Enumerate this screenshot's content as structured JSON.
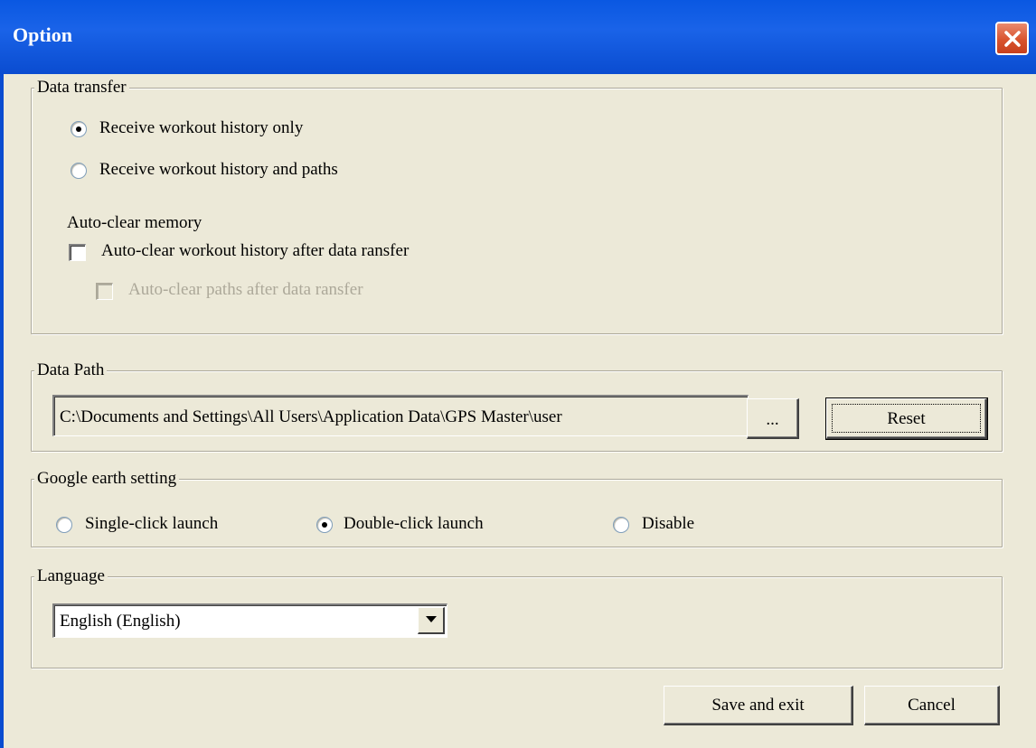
{
  "window": {
    "title": "Option"
  },
  "data_transfer": {
    "group_label": "Data transfer",
    "radio_options": [
      {
        "label": "Receive workout history only",
        "checked": true
      },
      {
        "label": "Receive workout history and paths",
        "checked": false
      }
    ],
    "auto_clear": {
      "heading": "Auto-clear memory",
      "history_checkbox": {
        "label": "Auto-clear workout history after data ransfer",
        "checked": false,
        "enabled": true
      },
      "paths_checkbox": {
        "label": "Auto-clear paths after data ransfer",
        "checked": false,
        "enabled": false
      }
    }
  },
  "data_path": {
    "group_label": "Data Path",
    "path_value": "C:\\Documents and Settings\\All Users\\Application Data\\GPS Master\\user",
    "browse_label": "...",
    "reset_label": "Reset"
  },
  "google_earth": {
    "group_label": "Google earth setting",
    "options": [
      {
        "label": "Single-click launch",
        "checked": false
      },
      {
        "label": "Double-click launch",
        "checked": true
      },
      {
        "label": "Disable",
        "checked": false
      }
    ]
  },
  "language": {
    "group_label": "Language",
    "selected": "English (English)"
  },
  "footer": {
    "save_label": "Save and exit",
    "cancel_label": "Cancel"
  },
  "colors": {
    "titlebar": "#0A58E2",
    "dialog_bg": "#ECE9D8",
    "close_button": "#D9532E",
    "group_border": "#ACA899",
    "disabled_text": "#ACA899"
  },
  "icons": {
    "close": "close-icon",
    "dropdown": "chevron-down-icon"
  }
}
